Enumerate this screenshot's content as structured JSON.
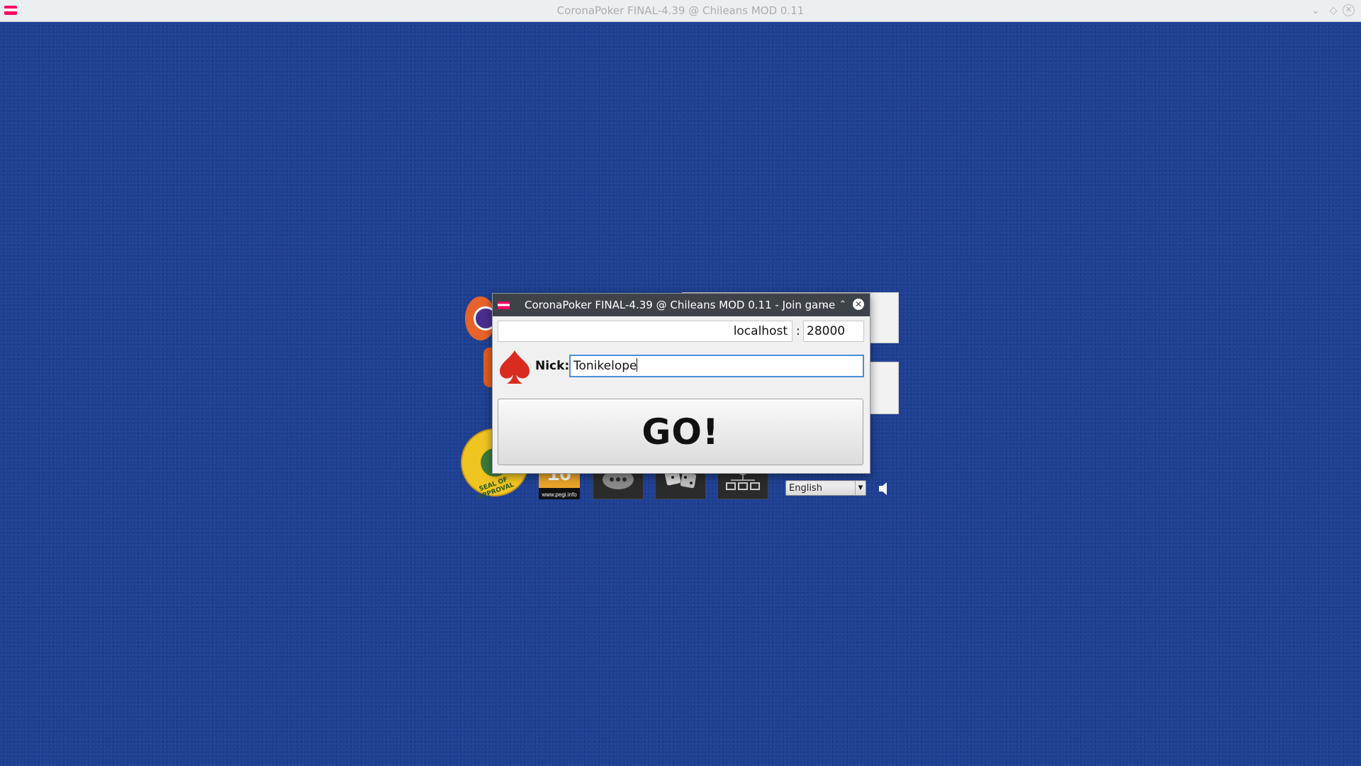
{
  "window": {
    "title": "CoronaPoker FINAL-4.39 @ Chileans MOD 0.11",
    "app_icon": "corona-poker-icon",
    "controls": [
      "minimize-icon",
      "maximize-icon",
      "close-icon"
    ]
  },
  "background": {
    "felt_color": "#1e4093",
    "pegi": {
      "age": "16",
      "url": "www.pegi.info"
    },
    "seal_text": "SEAL OF APPROVAL",
    "language": "English",
    "tiles": [
      "chat-bubble-icon",
      "dice-icon",
      "network-icon"
    ],
    "speaker": "speaker-icon"
  },
  "dialog": {
    "title": "CoronaPoker FINAL-4.39 @ Chileans MOD 0.11 - Join game",
    "host_value": "localhost",
    "separator": ":",
    "port_value": "28000",
    "nick_label": "Nick:",
    "nick_value": "Tonikelope",
    "go_label": "GO!",
    "accent": "#4b8ed8",
    "spade_color": "#d92b20"
  }
}
